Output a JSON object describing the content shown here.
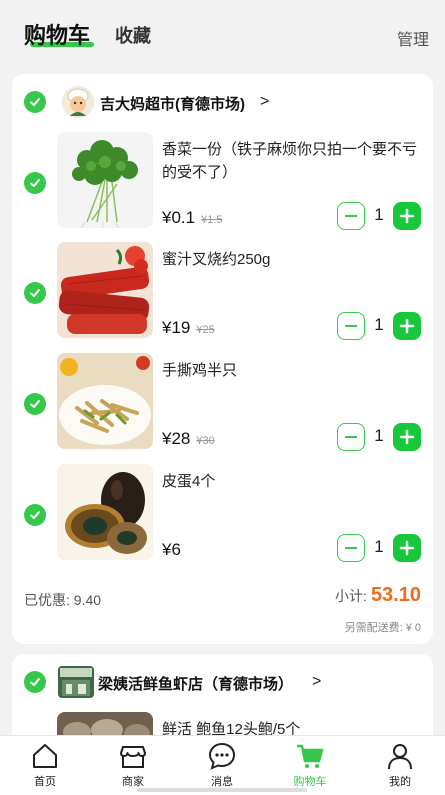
{
  "header": {
    "tab_cart": "购物车",
    "tab_favorites": "收藏",
    "manage": "管理"
  },
  "store1": {
    "name": "吉大妈超市(育德市场)",
    "arrow": ">",
    "items": [
      {
        "title": "香菜一份（铁子麻烦你只拍一个要不亏的受不了）",
        "price": "¥0.1",
        "orig": "¥1.5",
        "qty": "1",
        "image": "cilantro"
      },
      {
        "title": "蜜汁叉烧约250g",
        "price": "¥19",
        "orig": "¥25",
        "qty": "1",
        "image": "char-siu"
      },
      {
        "title": "手撕鸡半只",
        "price": "¥28",
        "orig": "¥30",
        "qty": "1",
        "image": "shredded-chicken"
      },
      {
        "title": "皮蛋4个",
        "price": "¥6",
        "orig": "",
        "qty": "1",
        "image": "century-egg"
      }
    ],
    "discount_label": "已优惠: 9.40",
    "subtotal_label": "小计:",
    "subtotal_value": "53.10",
    "delivery": "另需配送费: ¥ 0"
  },
  "store2": {
    "name": "梁姨活鲜鱼虾店（育德市场）",
    "arrow": ">",
    "first_item_title": "鲜活 鲍鱼12头鲍/5个"
  },
  "nav": {
    "items": [
      {
        "label": "首页",
        "icon": "home-icon"
      },
      {
        "label": "商家",
        "icon": "shop-icon"
      },
      {
        "label": "消息",
        "icon": "message-icon"
      },
      {
        "label": "购物车",
        "icon": "cart-icon"
      },
      {
        "label": "我的",
        "icon": "user-icon"
      }
    ],
    "active": "购物车"
  },
  "colors": {
    "accent": "#36c84a",
    "price_highlight": "#f06b1e"
  }
}
